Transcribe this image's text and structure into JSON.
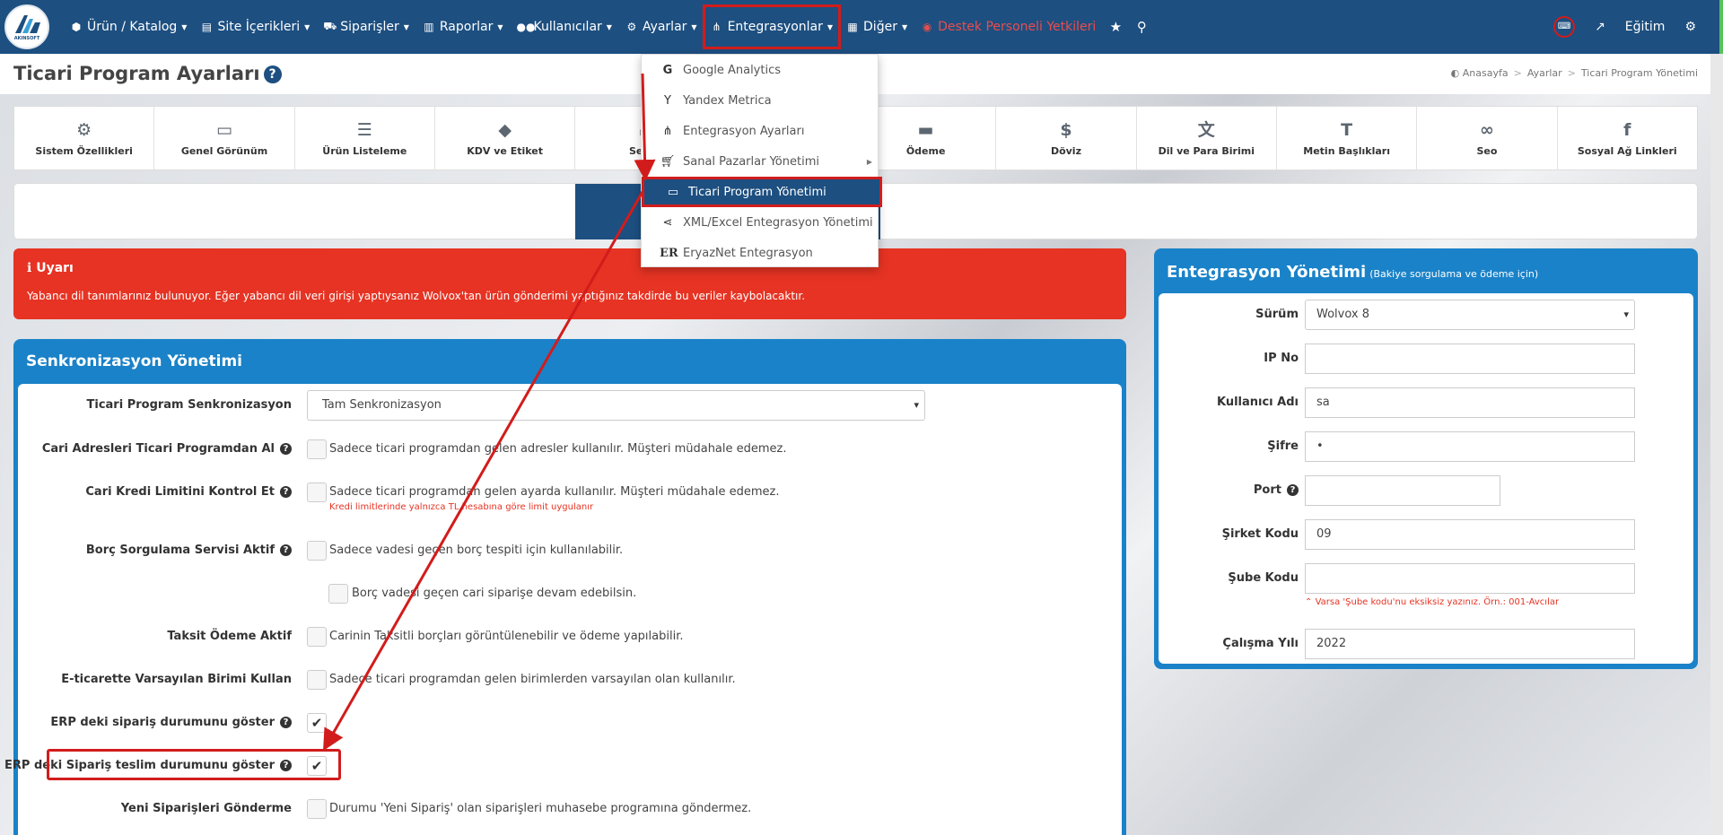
{
  "logo": {
    "text": "AKINSOFT"
  },
  "nav": {
    "items": [
      {
        "label": "Ürün / Katalog",
        "icon": "cubes-icon"
      },
      {
        "label": "Site İçerikleri",
        "icon": "files-icon"
      },
      {
        "label": "Siparişler",
        "icon": "truck-icon"
      },
      {
        "label": "Raporlar",
        "icon": "file-icon"
      },
      {
        "label": "Kullanıcılar",
        "icon": "users-icon"
      },
      {
        "label": "Ayarlar",
        "icon": "cogs-icon"
      },
      {
        "label": "Entegrasyonlar",
        "icon": "sitemap-icon"
      },
      {
        "label": "Diğer",
        "icon": "grid-icon"
      },
      {
        "label": "Destek Personeli Yetkileri",
        "icon": "user-circle-icon"
      }
    ],
    "education": "Eğitim"
  },
  "header": {
    "title": "Ticari Program Ayarları",
    "breadcrumb": [
      "Anasayfa",
      "Ayarlar",
      "Ticari Program Yönetimi"
    ]
  },
  "tabs": [
    "Sistem Özellikleri",
    "Genel Görünüm",
    "Ürün Listeleme",
    "KDV ve Etiket",
    "Sepet",
    "Ödeme",
    "Döviz",
    "Dil ve Para Birimi",
    "Metin Başlıkları",
    "Seo",
    "Sosyal Ağ Linkleri"
  ],
  "dropdown": {
    "items": [
      {
        "label": "Google Analytics",
        "icon": "google-icon"
      },
      {
        "label": "Yandex Metrica",
        "icon": "yandex-icon"
      },
      {
        "label": "Entegrasyon Ayarları",
        "icon": "sitemap-icon"
      },
      {
        "label": "Sanal Pazarlar Yönetimi",
        "icon": "cart-icon"
      },
      {
        "label": "Ticari Program Yönetimi",
        "icon": "laptop-icon"
      },
      {
        "label": "XML/Excel Entegrasyon Yönetimi",
        "icon": "share-icon"
      },
      {
        "label": "EryazNet Entegrasyon",
        "icon": "er-icon"
      }
    ],
    "selected": "Ticari Program Yönetimi"
  },
  "alert": {
    "title": "Uyarı",
    "text": "Yabancı dil tanımlarınız bulunuyor. Eğer yabancı dil veri girişi yaptıysanız Wolvox'tan ürün gönderimi yaptığınız takdirde bu veriler kaybolacaktır."
  },
  "sync": {
    "title": "Senkronizasyon Yönetimi",
    "program_sync": {
      "label": "Ticari Program Senkronizasyon",
      "value": "Tam Senkronizasyon"
    },
    "rows": [
      {
        "label": "Cari Adresleri Ticari Programdan Al",
        "desc": "Sadece ticari programdan gelen adresler kullanılır. Müşteri müdahale edemez.",
        "checked": false
      },
      {
        "label": "Cari Kredi Limitini Kontrol Et",
        "desc": "Sadece ticari programdan gelen ayarda kullanılır. Müşteri müdahale edemez.",
        "note": "Kredi limitlerinde yalnızca TL hesabına göre limit uygulanır",
        "checked": false
      },
      {
        "label": "Borç Sorgulama Servisi Aktif",
        "desc": "Sadece vadesi geçen borç tespiti için kullanılabilir.",
        "checked": false
      },
      {
        "label": "",
        "desc": "Borç vadesi geçen cari siparişe devam edebilsin.",
        "checked": false
      },
      {
        "label": "Taksit Ödeme Aktif",
        "desc": "Carinin Taksitli borçları görüntülenebilir ve ödeme yapılabilir.",
        "checked": false
      },
      {
        "label": "E-ticarette Varsayılan Birimi Kullan",
        "desc": "Sadece ticari programdan gelen birimlerden varsayılan olan kullanılır.",
        "checked": false
      },
      {
        "label": "ERP deki sipariş durumunu göster",
        "desc": "",
        "checked": true
      },
      {
        "label": "ERP deki Sipariş teslim durumunu göster",
        "desc": "",
        "checked": true
      },
      {
        "label": "Yeni Siparişleri Gönderme",
        "desc": "Durumu 'Yeni Sipariş' olan siparişleri muhasebe programına göndermez.",
        "checked": false
      }
    ]
  },
  "integration": {
    "title": "Entegrasyon Yönetimi",
    "subtitle": "(Bakiye sorgulama ve ödeme için)",
    "fields": [
      {
        "label": "Sürüm",
        "value": "Wolvox 8",
        "type": "select"
      },
      {
        "label": "IP No",
        "value": ""
      },
      {
        "label": "Kullanıcı Adı",
        "value": "sa"
      },
      {
        "label": "Şifre",
        "value": "•"
      },
      {
        "label": "Port",
        "value": ""
      },
      {
        "label": "Şirket Kodu",
        "value": "09"
      },
      {
        "label": "Şube Kodu",
        "value": "",
        "note": "Varsa 'Şube kodu'nu eksiksiz yazınız. Örn.: 001-Avcılar"
      },
      {
        "label": "Çalışma Yılı",
        "value": "2022"
      }
    ]
  },
  "colors": {
    "navy": "#1d4f80",
    "blue_panel": "#1a82c8",
    "alert_red": "#e63323",
    "highlight_red": "#d21c1c"
  }
}
